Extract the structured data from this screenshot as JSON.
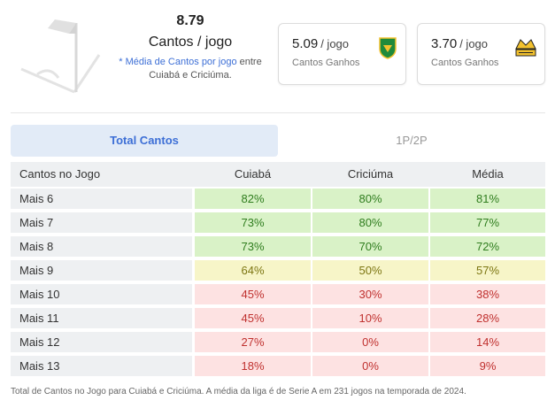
{
  "headline": {
    "value": "8.79",
    "unit": "Cantos / jogo",
    "note_prefix": "* Média de Cantos por jogo",
    "note_suffix": " entre",
    "note_line2": "Cuiabá e Criciúma."
  },
  "cards": [
    {
      "value": "5.09",
      "per": "/ jogo",
      "label": "Cantos Ganhos",
      "logo": "cuiaba-crest-icon",
      "logo_color": "#1f8a3b"
    },
    {
      "value": "3.70",
      "per": "/ jogo",
      "label": "Cantos Ganhos",
      "logo": "criciuma-crest-icon",
      "logo_color": "#f2c12e"
    }
  ],
  "tabs": [
    {
      "label": "Total Cantos",
      "active": true
    },
    {
      "label": "1P/2P",
      "active": false
    }
  ],
  "table": {
    "headers": [
      "Cantos no Jogo",
      "Cuiabá",
      "Criciúma",
      "Média"
    ],
    "rows": [
      [
        "Mais 6",
        "82%",
        "80%",
        "81%"
      ],
      [
        "Mais 7",
        "73%",
        "80%",
        "77%"
      ],
      [
        "Mais 8",
        "73%",
        "70%",
        "72%"
      ],
      [
        "Mais 9",
        "64%",
        "50%",
        "57%"
      ],
      [
        "Mais 10",
        "45%",
        "30%",
        "38%"
      ],
      [
        "Mais 11",
        "45%",
        "10%",
        "28%"
      ],
      [
        "Mais 12",
        "27%",
        "0%",
        "14%"
      ],
      [
        "Mais 13",
        "18%",
        "0%",
        "9%"
      ]
    ],
    "row_colors": [
      "g",
      "g",
      "g",
      "y",
      "r",
      "r",
      "r",
      "r"
    ],
    "colors": {
      "green": "#d9f2c7",
      "yellow": "#f7f5c8",
      "red": "#fde2e2"
    }
  },
  "footnote": "Total de Cantos no Jogo para Cuiabá e Criciúma. A média da liga é de Serie A em 231 jogos na temporada de 2024."
}
